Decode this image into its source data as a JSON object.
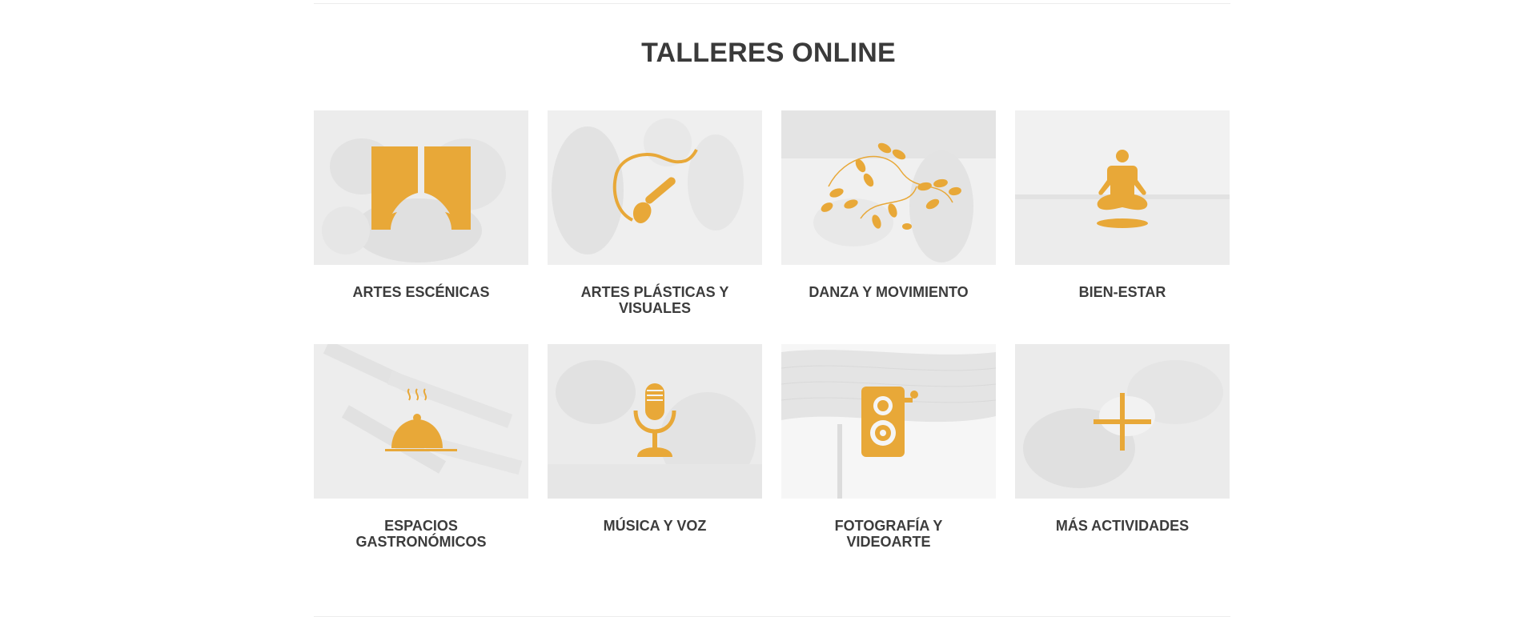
{
  "section": {
    "title": "TALLERES ONLINE"
  },
  "accent_color": "#E8A838",
  "cards": [
    {
      "label": "ARTES ESCÉNICAS",
      "icon": "theater-curtain-icon"
    },
    {
      "label": "ARTES PLÁSTICAS Y VISUALES",
      "icon": "paintbrush-icon"
    },
    {
      "label": "DANZA Y MOVIMIENTO",
      "icon": "dance-steps-icon"
    },
    {
      "label": "BIEN-ESTAR",
      "icon": "meditation-icon"
    },
    {
      "label": "ESPACIOS GASTRONÓMICOS",
      "icon": "cloche-icon"
    },
    {
      "label": "MÚSICA Y VOZ",
      "icon": "microphone-icon"
    },
    {
      "label": "FOTOGRAFÍA Y VIDEOARTE",
      "icon": "camera-icon"
    },
    {
      "label": "MÁS ACTIVIDADES",
      "icon": "plus-icon"
    }
  ]
}
